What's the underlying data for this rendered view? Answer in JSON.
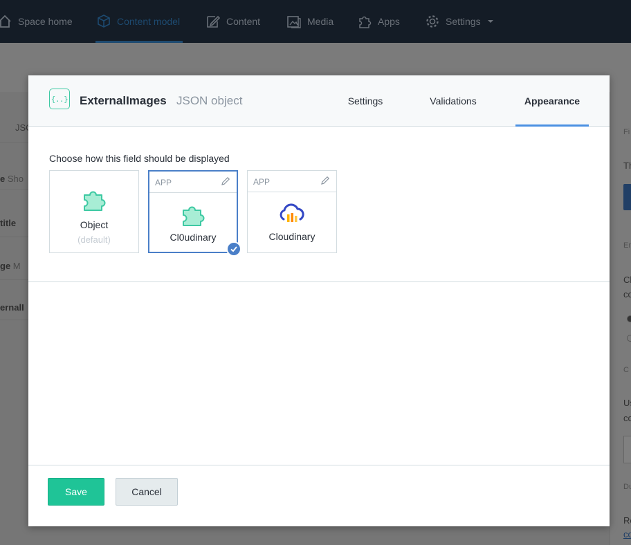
{
  "nav": {
    "items": [
      {
        "label": "Space home",
        "icon": "home-icon"
      },
      {
        "label": "Content model",
        "icon": "content-model-icon"
      },
      {
        "label": "Content",
        "icon": "content-icon"
      },
      {
        "label": "Media",
        "icon": "media-icon"
      },
      {
        "label": "Apps",
        "icon": "apps-icon"
      },
      {
        "label": "Settings",
        "icon": "gear-icon"
      }
    ],
    "active": "Content model"
  },
  "background": {
    "left_rows": [
      "JSO",
      "e",
      "Sho",
      "title",
      "ge",
      "M",
      "ernalI"
    ],
    "right_panel": [
      "Fi",
      "Th",
      "En",
      "Ch",
      "co",
      "C",
      "Us",
      "co",
      "Du",
      "Re",
      "co"
    ]
  },
  "modal": {
    "field_icon_text": "{..}",
    "field_name": "ExternalImages",
    "field_type": "JSON object",
    "tabs": [
      "Settings",
      "Validations",
      "Appearance"
    ],
    "active_tab": "Appearance",
    "prompt": "Choose how this field should be displayed",
    "options": [
      {
        "tag": "",
        "title": "Object",
        "subtitle": "(default)",
        "icon": "puzzle-icon",
        "selected": false
      },
      {
        "tag": "APP",
        "title": "Cl0udinary",
        "subtitle": "",
        "icon": "puzzle-icon",
        "selected": true
      },
      {
        "tag": "APP",
        "title": "Cloudinary",
        "subtitle": "",
        "icon": "cloudinary-logo-icon",
        "selected": false
      }
    ],
    "save_label": "Save",
    "cancel_label": "Cancel"
  },
  "colors": {
    "accent_green": "#1fc497",
    "accent_blue": "#4a90e2",
    "selected_border": "#4a7fc8",
    "puzzle_fill": "#a8edd5",
    "puzzle_stroke": "#3ec9a3"
  }
}
